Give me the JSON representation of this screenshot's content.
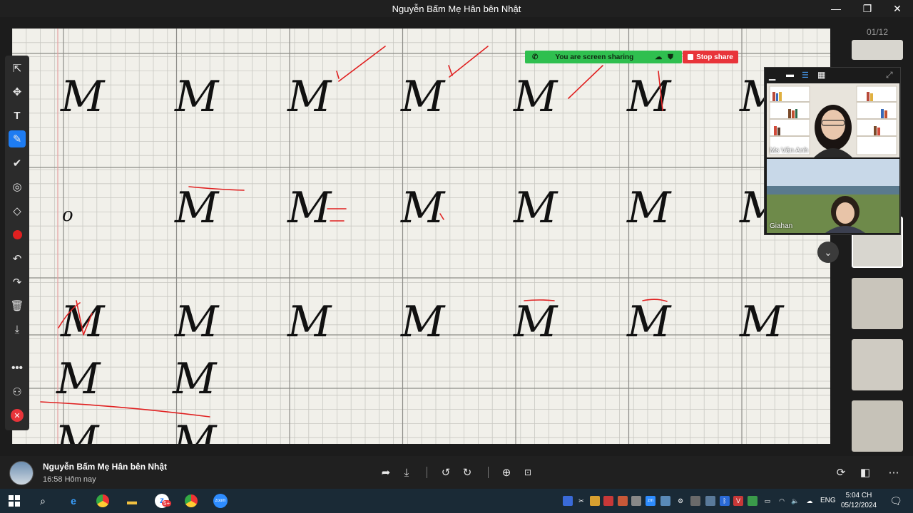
{
  "window": {
    "title": "Nguyễn Bấm Mẹ Hân bên Nhật",
    "minimize": "—",
    "restore": "❐",
    "close": "✕"
  },
  "thumbnails": {
    "page_counter": "01/12"
  },
  "annotation_toolbar": {
    "tools": [
      "select-icon",
      "move-icon",
      "text-icon",
      "pen-icon",
      "check-icon",
      "spotlight-icon",
      "eraser-icon",
      "color-icon",
      "undo-icon",
      "redo-icon",
      "delete-icon",
      "save-icon",
      "more-icon",
      "participant-icon",
      "close-icon"
    ],
    "active_tool": "pen-icon",
    "accent": "#1e7cf2"
  },
  "share_bar": {
    "label": "You are screen sharing",
    "stop_label": "Stop share",
    "bar_color": "#2fbf4f",
    "stop_color": "#e8343a"
  },
  "video_panel": {
    "participants": [
      {
        "name": "Ms Vân Anh"
      },
      {
        "name": "Giahan"
      }
    ]
  },
  "handwriting": {
    "glyph": "M",
    "small_glyph": "o",
    "ink_color": "#111111",
    "mark_color": "#e02020"
  },
  "info_bar": {
    "sender": "Nguyễn Bấm Mẹ Hân bên Nhật",
    "timestamp": "16:58 Hôm nay"
  },
  "taskbar": {
    "language": "ENG",
    "time": "5:04 CH",
    "date": "05/12/2024",
    "zalo_badge": "5+",
    "zoom_label": "zoom"
  }
}
